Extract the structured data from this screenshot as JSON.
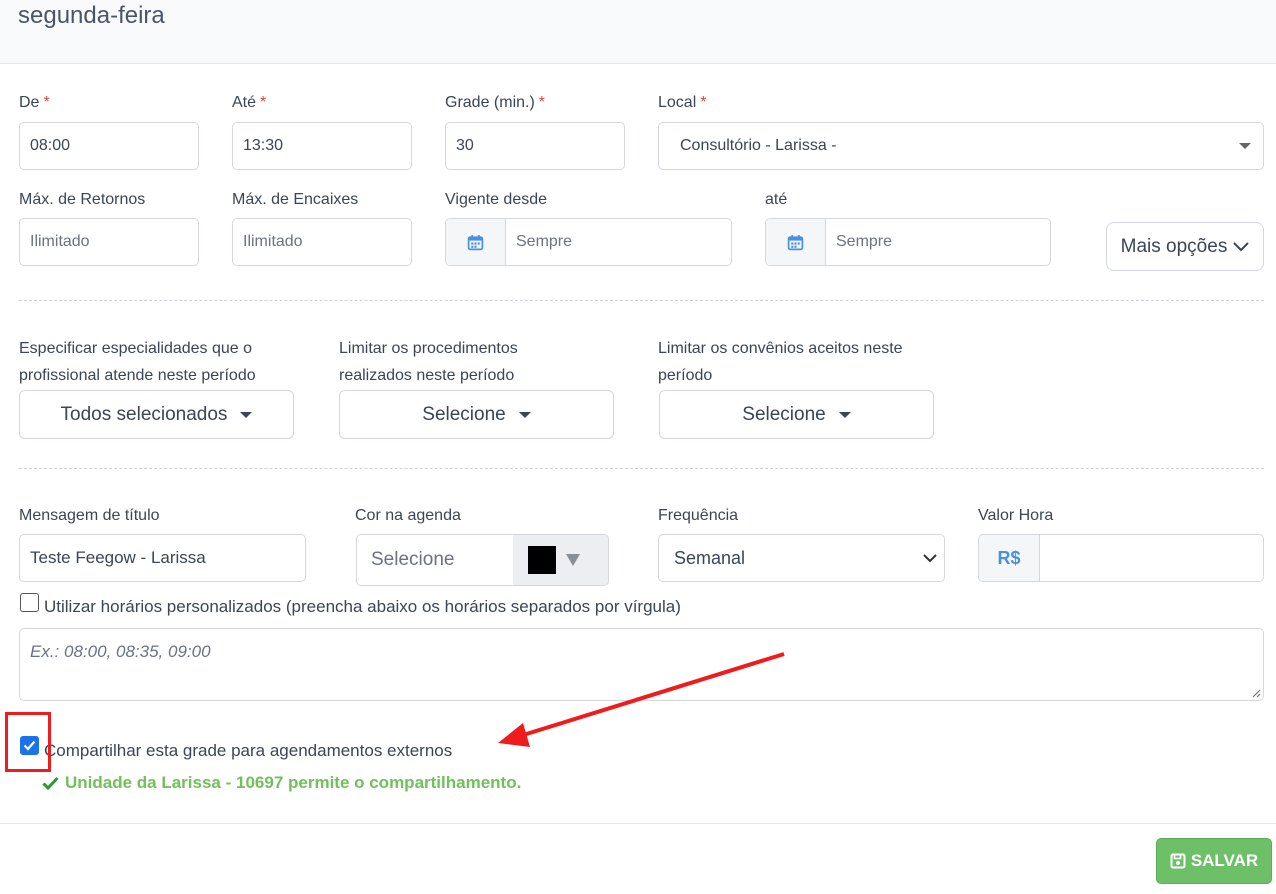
{
  "header": {
    "title": "segunda-feira"
  },
  "row1": {
    "de": {
      "label": "De",
      "required": "*",
      "value": "08:00"
    },
    "ate": {
      "label": "Até",
      "required": "*",
      "value": "13:30"
    },
    "grade": {
      "label": "Grade (min.)",
      "required": "*",
      "value": "30"
    },
    "local": {
      "label": "Local",
      "required": "*",
      "value": "Consultório - Larissa -"
    }
  },
  "row2": {
    "max_retornos": {
      "label": "Máx. de Retornos",
      "placeholder": "Ilimitado"
    },
    "max_encaixes": {
      "label": "Máx. de Encaixes",
      "placeholder": "Ilimitado"
    },
    "vigente_desde": {
      "label": "Vigente desde",
      "placeholder": "Sempre",
      "icon": "calendar-icon"
    },
    "vigente_ate": {
      "label": "até",
      "placeholder": "Sempre",
      "icon": "calendar-icon"
    },
    "mais_opcoes": "Mais opções"
  },
  "row3": {
    "especialidades": {
      "label_line1": "Especificar especialidades que o",
      "label_line2": "profissional atende neste período",
      "value": "Todos selecionados"
    },
    "procedimentos": {
      "label_line1": "Limitar os procedimentos",
      "label_line2": "realizados neste período",
      "value": "Selecione"
    },
    "convenios": {
      "label_line1": "Limitar os convênios aceitos neste",
      "label_line2": "período",
      "value": "Selecione"
    }
  },
  "row4": {
    "mensagem": {
      "label": "Mensagem de título",
      "value": "Teste Feegow - Larissa"
    },
    "cor": {
      "label": "Cor na agenda",
      "placeholder": "Selecione",
      "swatch": "#000000"
    },
    "frequencia": {
      "label": "Frequência",
      "value": "Semanal"
    },
    "valor_hora": {
      "label": "Valor Hora",
      "prefix": "R$",
      "value": ""
    }
  },
  "horarios": {
    "checkbox_label": "Utilizar horários personalizados (preencha abaixo os horários separados por vírgula)",
    "checked": false,
    "placeholder": "Ex.: 08:00, 08:35, 09:00"
  },
  "compartilhar": {
    "checkbox_label": "Compartilhar esta grade para agendamentos externos",
    "checked": true,
    "success_msg": "Unidade da Larissa - 10697 permite o compartilhamento."
  },
  "footer": {
    "save_label": "SALVAR"
  },
  "colors": {
    "accent": "#1a73e8",
    "success": "#72c05b",
    "save": "#6dc067",
    "required": "#e2463d",
    "annotation": "#ee1c1c"
  }
}
